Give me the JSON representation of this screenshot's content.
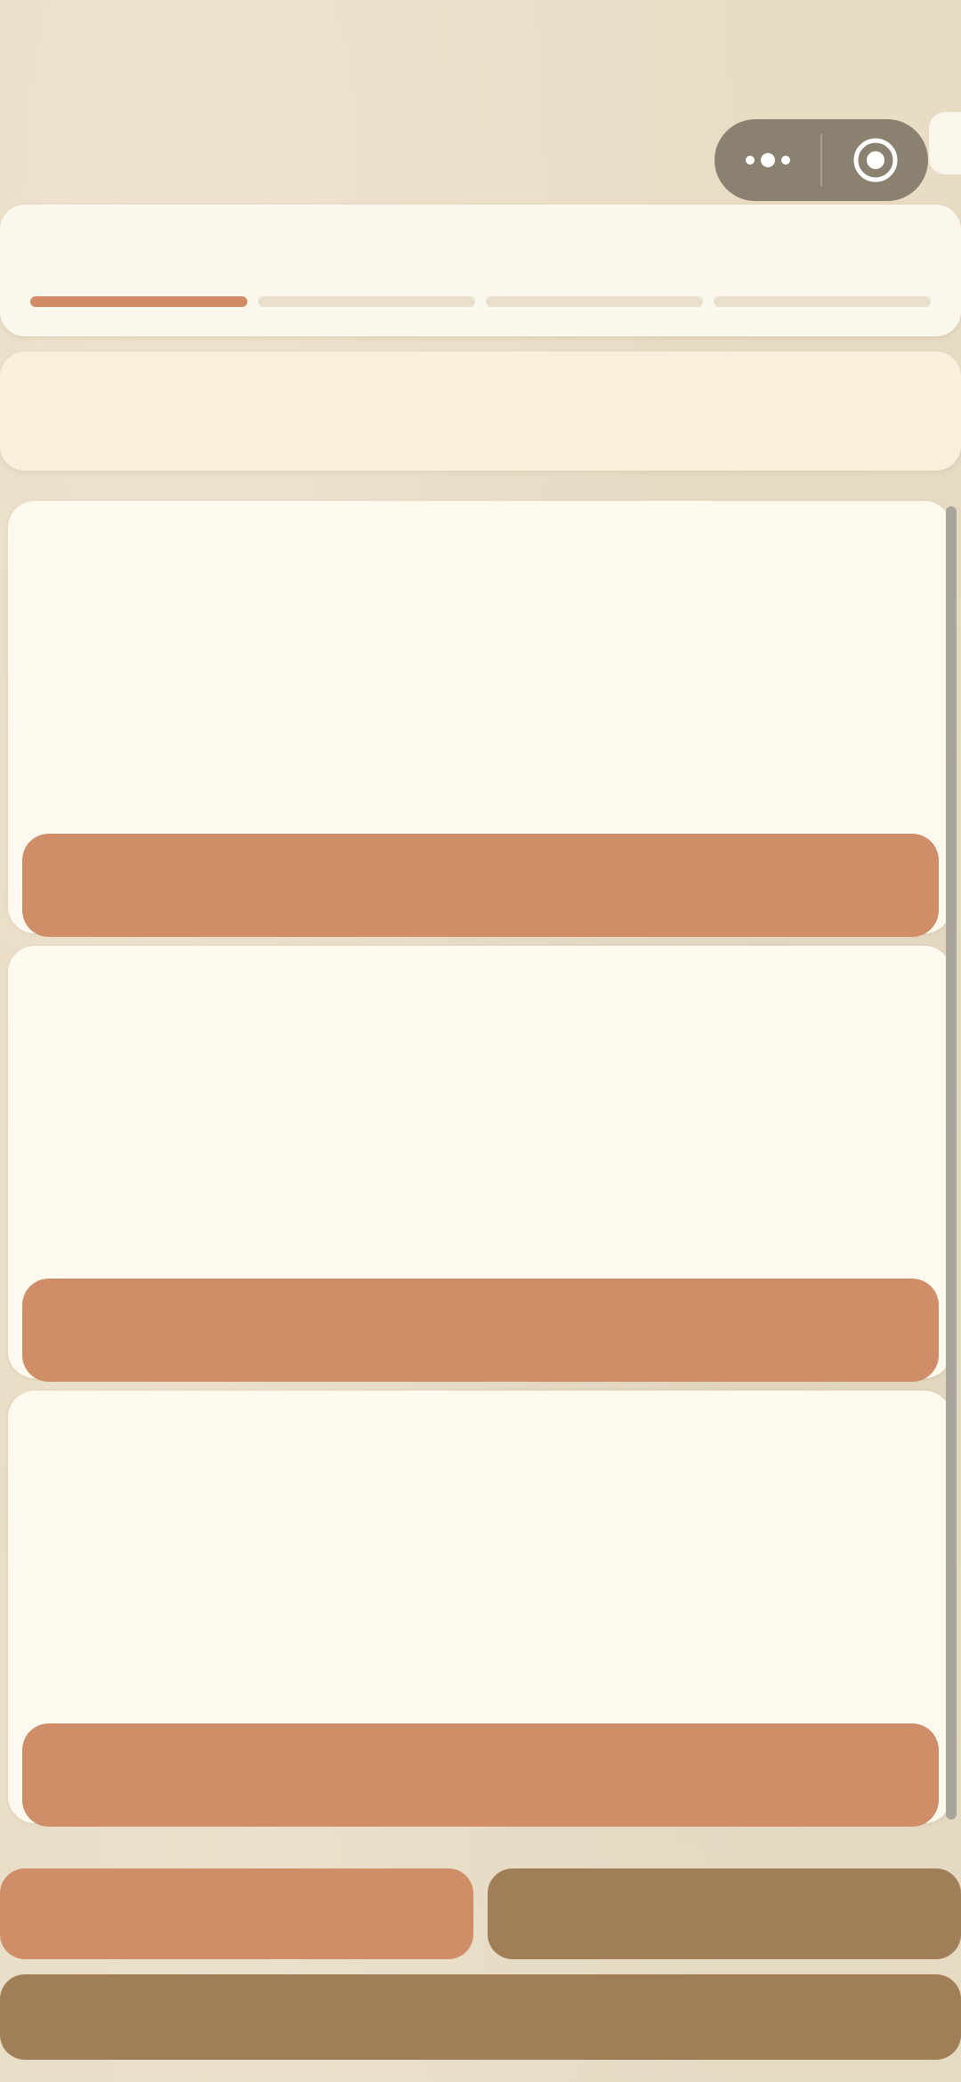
{
  "capsule": {
    "more_icon": "more-dots-icon",
    "close_icon": "target-circle-icon"
  },
  "progress": {
    "title": "",
    "total_steps": 4,
    "current_step": 1,
    "colors": {
      "active": "#cf8c66",
      "inactive": "#e8e0cc"
    }
  },
  "notice": {
    "text": ""
  },
  "items": [
    {
      "title": "",
      "description": "",
      "button_label": ""
    },
    {
      "title": "",
      "description": "",
      "button_label": ""
    },
    {
      "title": "",
      "description": "",
      "button_label": ""
    }
  ],
  "actions": {
    "left_label": "",
    "right_label": "",
    "bottom_label": ""
  },
  "colors": {
    "background": "#e8dcc4",
    "accent": "#cf8e67",
    "secondary": "#a07f58",
    "card": "#fdf9ef"
  }
}
